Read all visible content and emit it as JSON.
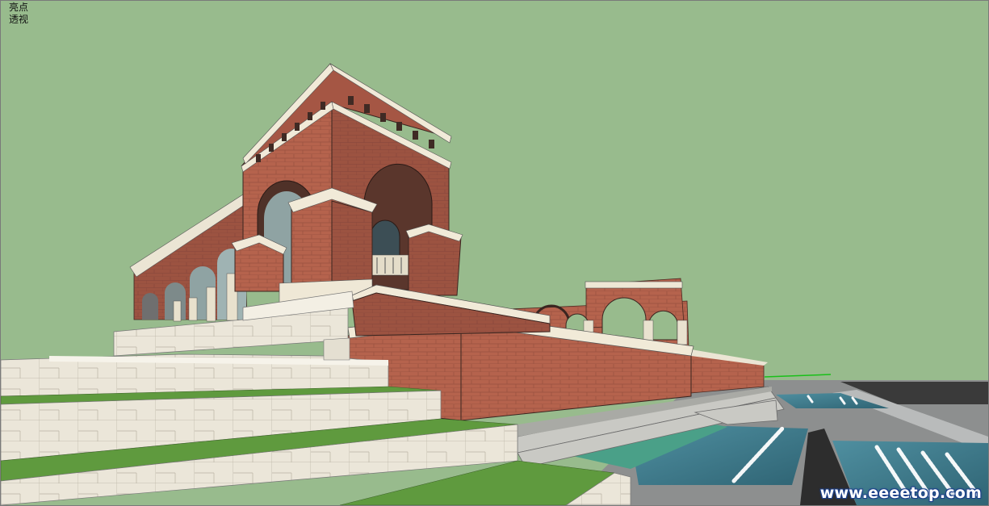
{
  "viewport": {
    "scene_name": "亮点",
    "camera_mode": "透视"
  },
  "watermark": "www.eeeetop.com",
  "colors": {
    "sky": "#98bb8d",
    "brick": "#b5634d",
    "stone": "#e9e4d6",
    "grass": "#5f9a3e",
    "water": "#3d7486"
  }
}
